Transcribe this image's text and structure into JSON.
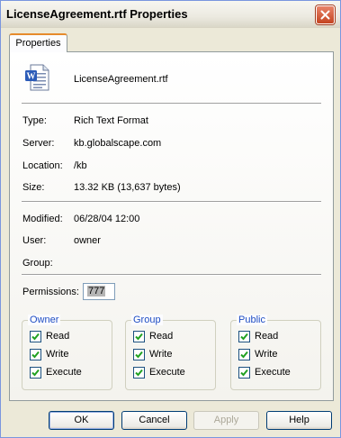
{
  "window": {
    "title": "LicenseAgreement.rtf Properties",
    "close_icon": "close-icon"
  },
  "tabs": [
    {
      "label": "Properties",
      "active": true
    }
  ],
  "file": {
    "icon": "word-document-icon",
    "name": "LicenseAgreement.rtf"
  },
  "info": {
    "type_label": "Type:",
    "type_value": "Rich Text Format",
    "server_label": "Server:",
    "server_value": "kb.globalscape.com",
    "location_label": "Location:",
    "location_value": "/kb",
    "size_label": "Size:",
    "size_value": "13.32 KB (13,637 bytes)",
    "modified_label": "Modified:",
    "modified_value": "06/28/04 12:00",
    "user_label": "User:",
    "user_value": "owner",
    "group_label": "Group:",
    "group_value": ""
  },
  "permissions": {
    "label": "Permissions:",
    "value": "777"
  },
  "groups": {
    "owner": {
      "title": "Owner",
      "read": "Read",
      "write": "Write",
      "execute": "Execute"
    },
    "group": {
      "title": "Group",
      "read": "Read",
      "write": "Write",
      "execute": "Execute"
    },
    "public": {
      "title": "Public",
      "read": "Read",
      "write": "Write",
      "execute": "Execute"
    }
  },
  "buttons": {
    "ok": "OK",
    "cancel": "Cancel",
    "apply": "Apply",
    "help": "Help"
  },
  "colors": {
    "tab_accent": "#E68B2C",
    "group_title": "#1F4EC3",
    "checkmark": "#21A121",
    "close_button": "#C44420"
  }
}
